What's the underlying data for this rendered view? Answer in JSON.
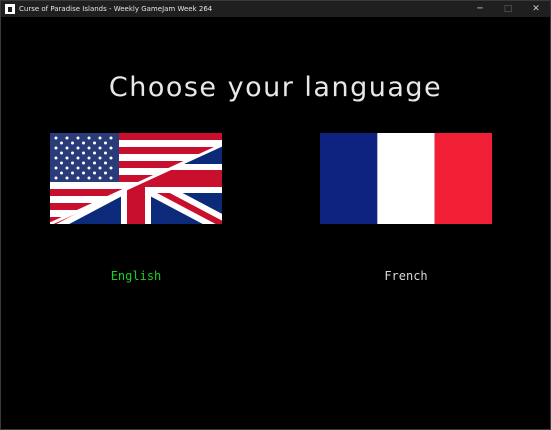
{
  "window": {
    "title": "Curse of Paradise Islands - Weekly GameJam Week 264",
    "minimize_glyph": "─",
    "maximize_glyph": "□",
    "close_glyph": "✕"
  },
  "screen": {
    "heading": "Choose your language"
  },
  "languages": [
    {
      "label": "English",
      "flag": "us-uk-split-flag",
      "selected": true,
      "color": "#19d11e"
    },
    {
      "label": "French",
      "flag": "france-flag",
      "selected": false,
      "color": "#d8d8d8"
    }
  ],
  "colors": {
    "background": "#000000",
    "selected": "#19d11e",
    "unselected": "#d8d8d8",
    "flag_blue": "#0a2a8a",
    "flag_red": "#d11a2a",
    "fr_blue": "#002395",
    "fr_red": "#ed2939"
  }
}
